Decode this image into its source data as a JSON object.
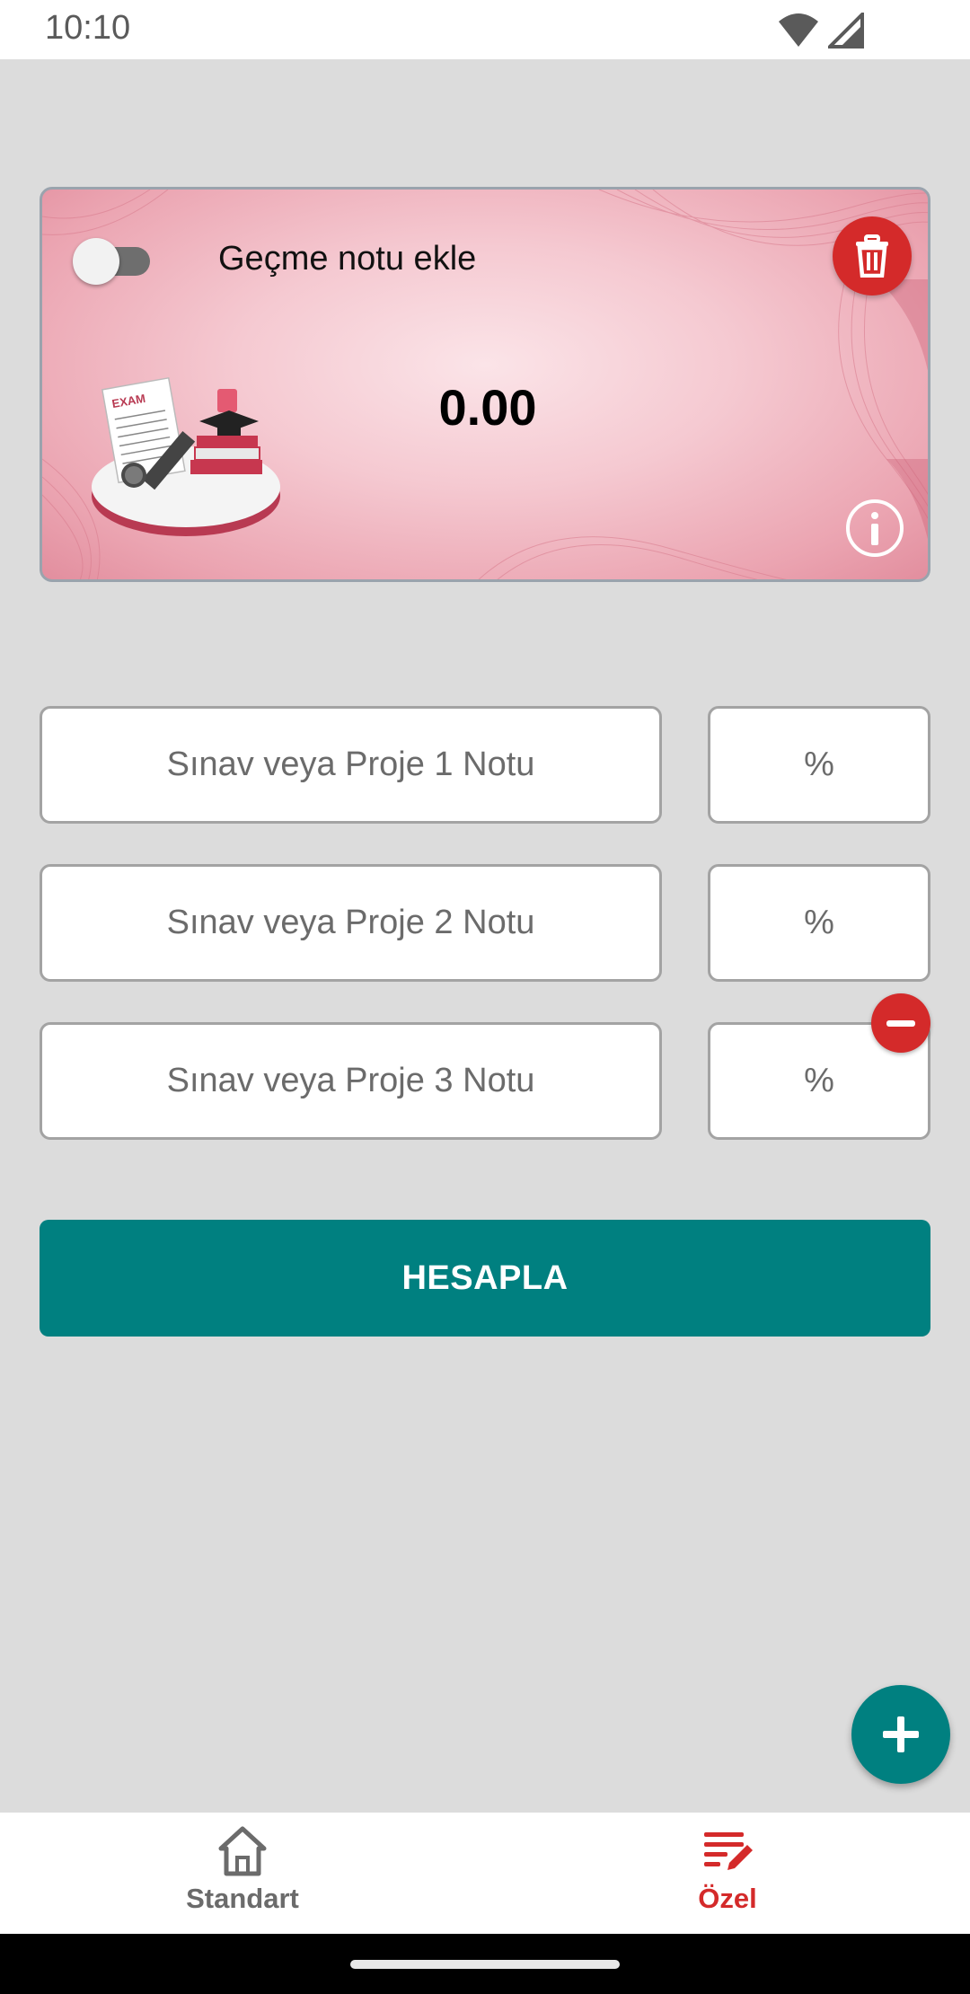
{
  "status_bar": {
    "time": "10:10"
  },
  "card": {
    "toggle_label": "Geçme notu ekle",
    "toggle_on": false,
    "result_value": "0.00",
    "illustration_text": "EXAM"
  },
  "fields": [
    {
      "placeholder": "Sınav veya Proje  1 Notu",
      "percent_placeholder": "%"
    },
    {
      "placeholder": "Sınav veya Proje  2 Notu",
      "percent_placeholder": "%"
    },
    {
      "placeholder": "Sınav veya Proje  3 Notu",
      "percent_placeholder": "%"
    }
  ],
  "actions": {
    "calculate_label": "HESAPLA"
  },
  "bottom_nav": {
    "items": [
      {
        "label": "Standart",
        "icon": "home-icon",
        "active": false
      },
      {
        "label": "Özel",
        "icon": "edit-list-icon",
        "active": true
      }
    ]
  },
  "colors": {
    "accent": "#008080",
    "danger": "#d42a2a",
    "nav_active": "#d42a2a",
    "nav_inactive": "#6b6b6b",
    "background": "#dcdcdc"
  }
}
